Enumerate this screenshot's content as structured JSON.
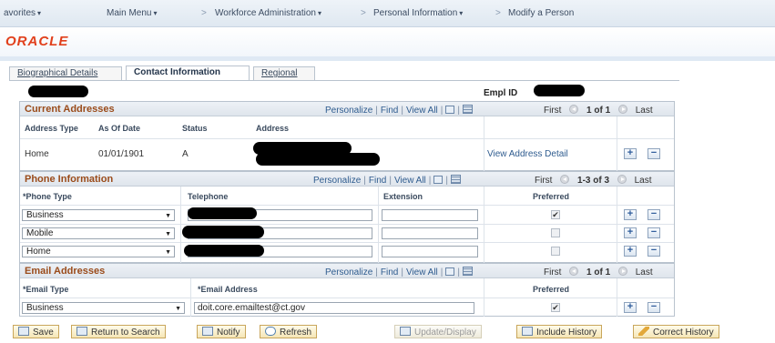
{
  "nav": {
    "favorites": "avorites",
    "main_menu": "Main Menu",
    "crumbs": [
      "Workforce Administration",
      "Personal Information",
      "Modify a Person"
    ],
    "separator": ">"
  },
  "brand": {
    "logo_text": "ORACLE"
  },
  "tabs": [
    {
      "label": "Biographical Details",
      "active": false
    },
    {
      "label": "Contact Information",
      "active": true
    },
    {
      "label": "Regional",
      "active": false
    }
  ],
  "person": {
    "emplid_label": "Empl ID"
  },
  "grid_tools": {
    "personalize": "Personalize",
    "find": "Find",
    "view_all": "View All",
    "divider": "|",
    "first": "First",
    "last": "Last"
  },
  "current_addresses": {
    "title": "Current Addresses",
    "range": "1 of 1",
    "columns": [
      "Address Type",
      "As Of Date",
      "Status",
      "Address"
    ],
    "rows": [
      {
        "address_type": "Home",
        "as_of_date": "01/01/1901",
        "status": "A",
        "detail_link": "View Address Detail"
      }
    ]
  },
  "phone_information": {
    "title": "Phone Information",
    "range": "1-3 of 3",
    "columns": [
      "*Phone Type",
      "Telephone",
      "Extension",
      "Preferred"
    ],
    "rows": [
      {
        "phone_type": "Business",
        "extension": "",
        "preferred": true
      },
      {
        "phone_type": "Mobile",
        "extension": "",
        "preferred": false
      },
      {
        "phone_type": "Home",
        "extension": "",
        "preferred": false
      }
    ]
  },
  "email_addresses": {
    "title": "Email Addresses",
    "range": "1 of 1",
    "columns": [
      "*Email Type",
      "*Email Address",
      "Preferred"
    ],
    "rows": [
      {
        "email_type": "Business",
        "email_address": "doit.core.emailtest@ct.gov",
        "preferred": true
      }
    ]
  },
  "row_actions": {
    "add": "+",
    "remove": "−"
  },
  "toolbar": {
    "save": "Save",
    "return_to_search": "Return to Search",
    "notify": "Notify",
    "refresh": "Refresh",
    "update_display": "Update/Display",
    "include_history": "Include History",
    "correct_history": "Correct History"
  },
  "checkmark": "✔",
  "caret": "▾",
  "select_arrow": "▼"
}
